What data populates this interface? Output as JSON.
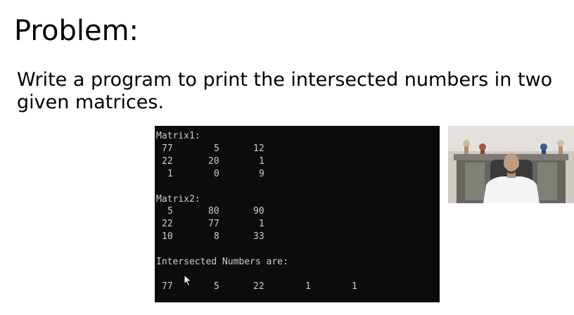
{
  "slide": {
    "title": "Problem:",
    "description": "Write a program to print the intersected numbers in two given matrices."
  },
  "console": {
    "matrix1_label": "Matrix1:",
    "matrix1_rows": [
      [
        "77",
        "5",
        "12"
      ],
      [
        "22",
        "20",
        "1"
      ],
      [
        "1",
        "0",
        "9"
      ]
    ],
    "matrix2_label": "Matrix2:",
    "matrix2_rows": [
      [
        "5",
        "80",
        "90"
      ],
      [
        "22",
        "77",
        "1"
      ],
      [
        "10",
        "8",
        "33"
      ]
    ],
    "result_label": "Intersected Numbers are:",
    "result_values": [
      "77",
      "5",
      "22",
      "1",
      "1"
    ]
  },
  "colors": {
    "console_background": "#0c0c0c",
    "console_text": "#cccccc",
    "slide_background": "#ffffff"
  },
  "icons": {
    "cursor": "mouse-pointer-icon"
  }
}
